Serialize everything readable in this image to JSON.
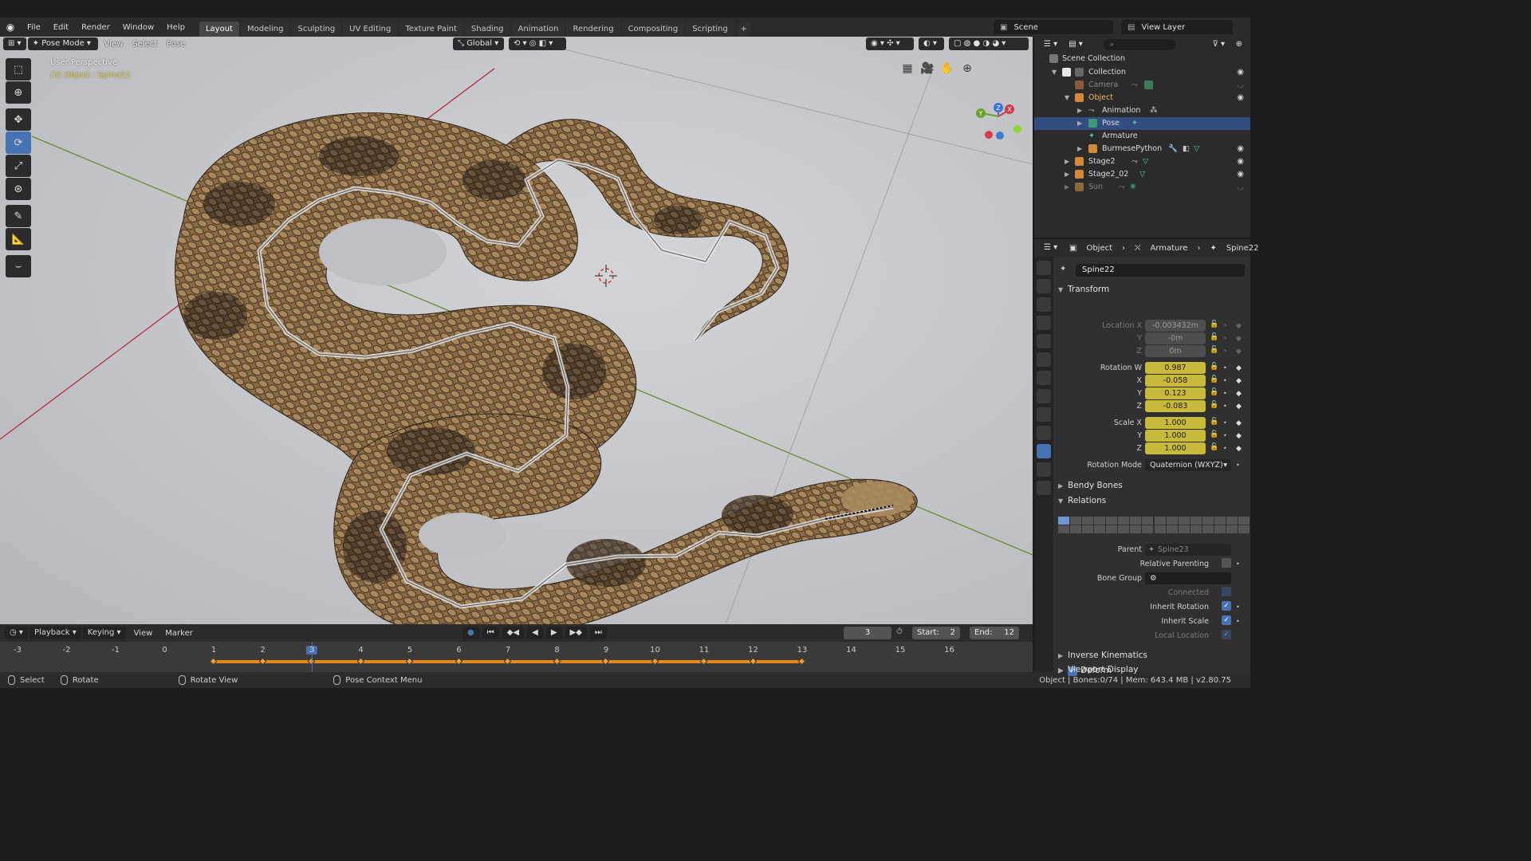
{
  "menu": [
    "File",
    "Edit",
    "Render",
    "Window",
    "Help"
  ],
  "workspaces": [
    "Layout",
    "Modeling",
    "Sculpting",
    "UV Editing",
    "Texture Paint",
    "Shading",
    "Animation",
    "Rendering",
    "Compositing",
    "Scripting"
  ],
  "active_workspace": "Layout",
  "add_workspace": "+",
  "scene_name": "Scene",
  "view_layer": "View Layer",
  "viewport": {
    "mode": "Pose Mode",
    "menus": [
      "View",
      "Select",
      "Pose"
    ],
    "orientation": "Global",
    "overlay_title": "User Perspective",
    "overlay_object": "(3) Object : Spine22",
    "gizmo_axes": [
      "X",
      "Y",
      "Z"
    ]
  },
  "tools": [
    "select-box",
    "cursor",
    "move",
    "rotate",
    "scale",
    "transform",
    "annotate",
    "measure",
    "relax"
  ],
  "timeline": {
    "menus": [
      "Playback",
      "Keying",
      "View",
      "Marker"
    ],
    "current_frame": "3",
    "start_label": "Start:",
    "start": "2",
    "end_label": "End:",
    "end": "12",
    "ticks": [
      "-3",
      "-2",
      "-1",
      "0",
      "1",
      "2",
      "3",
      "4",
      "5",
      "6",
      "7",
      "8",
      "9",
      "10",
      "11",
      "12",
      "13",
      "14",
      "15",
      "16"
    ],
    "keyframes": [
      1,
      2,
      3,
      4,
      5,
      6,
      7,
      8,
      9,
      10,
      11,
      12,
      13
    ]
  },
  "statusbar": {
    "select": "Select",
    "rotate": "Rotate",
    "rotate_view": "Rotate View",
    "context": "Pose Context Menu",
    "stats": "Object | Bones:0/74 | Mem: 643.4 MB | v2.80.75"
  },
  "outliner": {
    "search_placeholder": "",
    "rows": [
      {
        "label": "Scene Collection"
      },
      {
        "label": "Collection"
      },
      {
        "label": "Camera"
      },
      {
        "label": "Object"
      },
      {
        "label": "Animation"
      },
      {
        "label": "Pose"
      },
      {
        "label": "Armature"
      },
      {
        "label": "BurmesePython"
      },
      {
        "label": "Stage2"
      },
      {
        "label": "Stage2_02"
      },
      {
        "label": "Sun"
      }
    ]
  },
  "properties": {
    "breadcrumb": [
      "Object",
      "Armature",
      "Spine22"
    ],
    "bone_name": "Spine22",
    "transform_title": "Transform",
    "location_x_label": "Location X",
    "location_x": "-0.003432m",
    "location_y": "-0m",
    "location_z": "0m",
    "rotation_w_label": "Rotation W",
    "rotation_w": "0.987",
    "rotation_x": "-0.058",
    "rotation_y": "0.123",
    "rotation_z": "-0.083",
    "scale_x_label": "Scale X",
    "scale_x": "1.000",
    "scale_y": "1.000",
    "scale_z": "1.000",
    "axis_y": "Y",
    "axis_z": "Z",
    "axis_x": "X",
    "rotation_mode_label": "Rotation Mode",
    "rotation_mode": "Quaternion (WXYZ)",
    "bendy_bones": "Bendy Bones",
    "relations": "Relations",
    "parent_label": "Parent",
    "parent": "Spine23",
    "relative_parenting": "Relative Parenting",
    "bone_group_label": "Bone Group",
    "connected": "Connected",
    "inherit_rotation": "Inherit Rotation",
    "inherit_scale": "Inherit Scale",
    "local_location": "Local Location",
    "inverse_kinematics": "Inverse Kinematics",
    "deform": "Deform",
    "viewport_display": "Viewport Display"
  },
  "colors": {
    "accent_blue": "#4772b3",
    "keyframe_orange": "#e8891c",
    "field_yellow": "#c9b93a",
    "overlay_yellow": "#e0d04a"
  }
}
